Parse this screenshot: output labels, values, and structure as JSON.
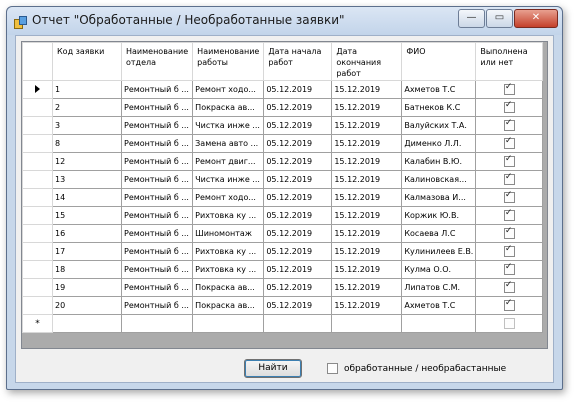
{
  "window": {
    "title": "Отчет \"Обработанные / Необработанные заявки\""
  },
  "columns": [
    "Код заявки",
    "Наименование отдела",
    "Наименование работы",
    "Дата начала работ",
    "Дата окончания работ",
    "ФИО",
    "Выполнена или нет"
  ],
  "rows": [
    [
      "1",
      "Ремонтный б ...",
      "Ремонт ходо...",
      "05.12.2019",
      "15.12.2019",
      "Ахметов Т.С",
      true
    ],
    [
      "2",
      "Ремонтный б ...",
      "Покраска ав...",
      "05.12.2019",
      "15.12.2019",
      "Батнеков К.С",
      true
    ],
    [
      "3",
      "Ремонтный б ...",
      "Чистка инже ...",
      "05.12.2019",
      "15.12.2019",
      "Валуйских Т.А.",
      true
    ],
    [
      "8",
      "Ремонтный б ...",
      "Замена авто ...",
      "05.12.2019",
      "15.12.2019",
      "Дименко Л.Л.",
      true
    ],
    [
      "12",
      "Ремонтный б ...",
      "Ремонт двиг...",
      "05.12.2019",
      "15.12.2019",
      "Калабин В.Ю.",
      true
    ],
    [
      "13",
      "Ремонтный б ...",
      "Чистка инже ...",
      "05.12.2019",
      "15.12.2019",
      "Калиновская...",
      true
    ],
    [
      "14",
      "Ремонтный б ...",
      "Ремонт ходо...",
      "05.12.2019",
      "15.12.2019",
      "Калмазова И...",
      true
    ],
    [
      "15",
      "Ремонтный б ...",
      "Рихтовка ку ...",
      "05.12.2019",
      "15.12.2019",
      "Коржик Ю.В.",
      true
    ],
    [
      "16",
      "Ремонтный б ...",
      "Шиномонтаж",
      "05.12.2019",
      "15.12.2019",
      "Косаева Л.С",
      true
    ],
    [
      "17",
      "Ремонтный б ...",
      "Рихтовка ку ...",
      "05.12.2019",
      "15.12.2019",
      "Кулинилеев Е.В.",
      true
    ],
    [
      "18",
      "Ремонтный б ...",
      "Рихтовка ку ...",
      "05.12.2019",
      "15.12.2019",
      "Кулма О.О.",
      true
    ],
    [
      "19",
      "Ремонтный б ...",
      "Покраска ав...",
      "05.12.2019",
      "15.12.2019",
      "Липатов С.М.",
      true
    ],
    [
      "20",
      "Ремонтный б ...",
      "Покраска ав...",
      "05.12.2019",
      "15.12.2019",
      "Ахметов Т.С",
      true
    ]
  ],
  "new_row_marker": "*",
  "buttons": {
    "find": "Найти"
  },
  "filter": {
    "label": "обработанные / необрабастанные",
    "checked": false
  }
}
